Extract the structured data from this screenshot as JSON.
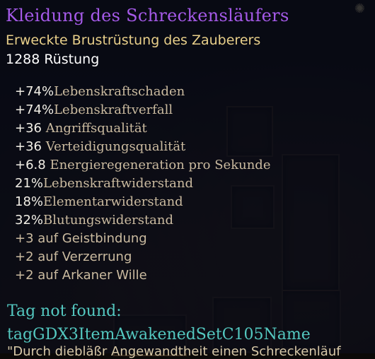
{
  "background": {
    "corner_icon": "sun-icon",
    "corner_glyph": "✺"
  },
  "tooltip": {
    "title": "Kleidung des Schreckensläufers",
    "subtitle": "Erweckte Brustrüstung des Zauberers",
    "armor": "1288 Rüstung",
    "stats": [
      {
        "value": "+74%",
        "text": "Lebenskraftschaden"
      },
      {
        "value": "+74%",
        "text": "Lebenskraftverfall"
      },
      {
        "value": "+36",
        "text": "Angriffsqualität"
      },
      {
        "value": "+36",
        "text": "Verteidigungsqualität"
      },
      {
        "value": "+6.8",
        "text": "Energieregeneration pro Sekunde"
      },
      {
        "value": "21%",
        "text": "Lebenskraftwiderstand"
      },
      {
        "value": "18%",
        "text": "Elementarwiderstand"
      },
      {
        "value": "32%",
        "text": "Blutungswiderstand"
      },
      {
        "value": "+3 auf Geistbindung",
        "text": ""
      },
      {
        "value": "+2 auf Verzerrung",
        "text": ""
      },
      {
        "value": "+2 auf Arkaner Wille",
        "text": ""
      }
    ],
    "missing_line1": "Tag not found:",
    "missing_line2": "tagGDX3ItemAwakenedSetC105Name",
    "description": "\"Durch diebläßr Angewandtheit einen Schreckenläuf"
  },
  "colors": {
    "title": "#a55ae8",
    "subtitle": "#e8cf8a",
    "armor": "#ffffff",
    "stat_value": "#f2efe6",
    "stat_text": "#cbbba0",
    "missing_tag": "#54c8c0"
  }
}
